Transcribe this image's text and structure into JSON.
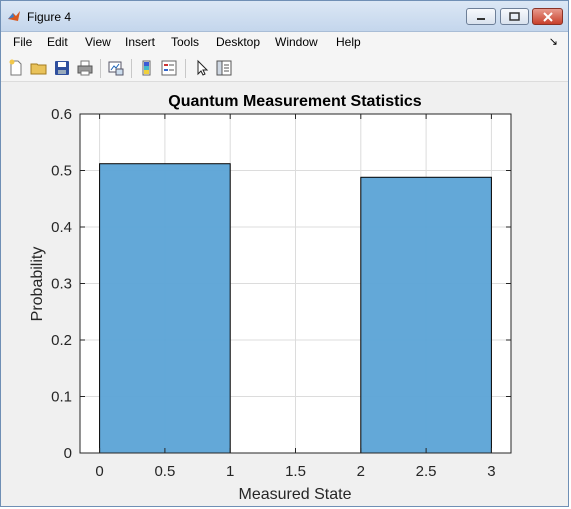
{
  "window": {
    "title": "Figure 4"
  },
  "menu": [
    "File",
    "Edit",
    "View",
    "Insert",
    "Tools",
    "Desktop",
    "Window",
    "Help"
  ],
  "toolbar": [
    "new-figure-icon",
    "open-file-icon",
    "save-icon",
    "print-icon",
    "link-plot-icon",
    "insert-colorbar-icon",
    "insert-legend-icon",
    "edit-plot-icon",
    "property-inspector-icon"
  ],
  "colors": {
    "bar_fill": "#5ba3d6",
    "bar_edge": "#000000",
    "grid": "#dcdcdc"
  },
  "chart_data": {
    "type": "bar",
    "title": "Quantum Measurement Statistics",
    "xlabel": "Measured State",
    "ylabel": "Probability",
    "xlim": [
      -0.15,
      3.15
    ],
    "ylim": [
      0,
      0.6
    ],
    "xticks": [
      "0",
      "0.5",
      "1",
      "1.5",
      "2",
      "2.5",
      "3"
    ],
    "yticks": [
      "0",
      "0.1",
      "0.2",
      "0.3",
      "0.4",
      "0.5",
      "0.6"
    ],
    "bars": [
      {
        "x_start": 0,
        "x_end": 1,
        "value": 0.512
      },
      {
        "x_start": 2,
        "x_end": 3,
        "value": 0.488
      }
    ],
    "grid": true
  }
}
